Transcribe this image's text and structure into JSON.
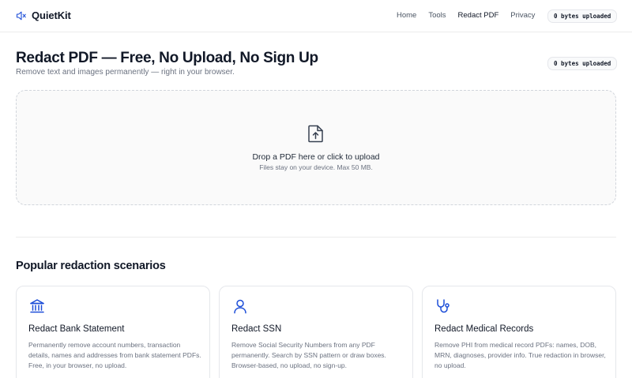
{
  "brand": {
    "name": "QuietKit",
    "icon": "speaker-muted-icon"
  },
  "nav": {
    "items": [
      {
        "label": "Home"
      },
      {
        "label": "Tools"
      },
      {
        "label": "Redact PDF"
      },
      {
        "label": "Privacy"
      }
    ],
    "badge": "0 bytes uploaded"
  },
  "hero": {
    "title": "Redact PDF — Free, No Upload, No Sign Up",
    "subtitle": "Remove text and images permanently — right in your browser.",
    "badge": "0 bytes uploaded"
  },
  "dropzone": {
    "icon": "file-upload-icon",
    "main": "Drop a PDF here or click to upload",
    "sub": "Files stay on your device. Max 50 MB."
  },
  "scenarios": {
    "title": "Popular redaction scenarios",
    "cards": [
      {
        "icon": "bank-icon",
        "title": "Redact Bank Statement",
        "desc": "Permanently remove account numbers, transaction details, names and addresses from bank statement PDFs. Free, in your browser, no upload."
      },
      {
        "icon": "user-icon",
        "title": "Redact SSN",
        "desc": "Remove Social Security Numbers from any PDF permanently. Search by SSN pattern or draw boxes. Browser-based, no upload, no sign-up."
      },
      {
        "icon": "stethoscope-icon",
        "title": "Redact Medical Records",
        "desc": "Remove PHI from medical record PDFs: names, DOB, MRN, diagnoses, provider info. True redaction in browser, no upload."
      }
    ]
  },
  "colors": {
    "accent": "#1d4ed8",
    "text": "#111827",
    "muted": "#6b7280",
    "border": "#e5e7eb"
  }
}
